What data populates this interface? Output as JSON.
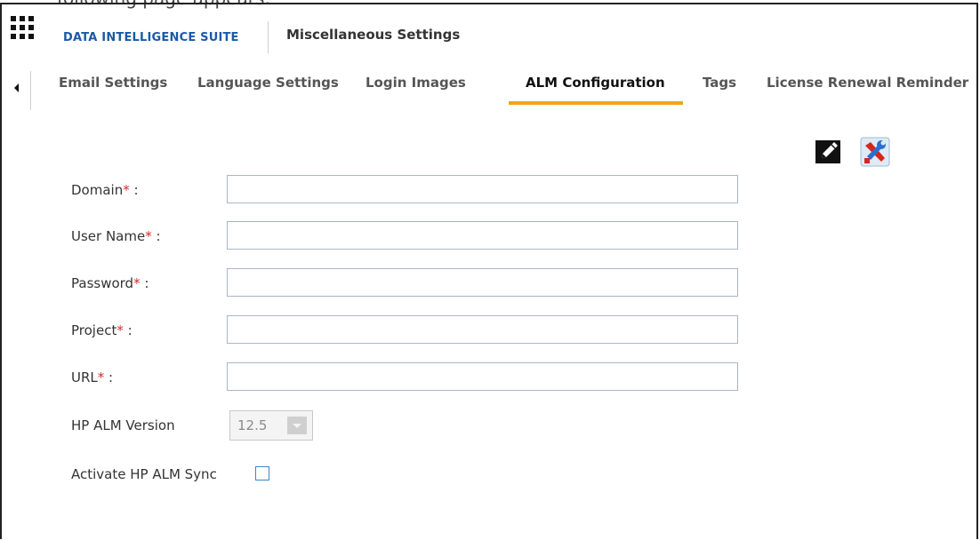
{
  "top_caption": "following page appears:",
  "header": {
    "app_menu_icon": "grid-icon",
    "suite_title": "DATA INTELLIGENCE SUITE",
    "page_title": "Miscellaneous Settings"
  },
  "tabs": [
    {
      "label": "Email Settings",
      "active": false
    },
    {
      "label": "Language Settings",
      "active": false
    },
    {
      "label": "Login Images",
      "active": false
    },
    {
      "label": "ALM Configuration",
      "active": true
    },
    {
      "label": "Tags",
      "active": false
    },
    {
      "label": "License Renewal Reminder",
      "active": false
    }
  ],
  "tab_scroll_icon": "caret-left-icon",
  "toolbar": {
    "edit_icon": "edit-pencil-icon",
    "config_icon": "tools-icon"
  },
  "form": {
    "fields": [
      {
        "label": "Domain",
        "required_mark": "*",
        "suffix": " :",
        "value": ""
      },
      {
        "label": "User Name",
        "required_mark": "*",
        "suffix": " :",
        "value": ""
      },
      {
        "label": "Password",
        "required_mark": "*",
        "suffix": " :",
        "value": ""
      },
      {
        "label": "Project",
        "required_mark": "*",
        "suffix": " :",
        "value": ""
      },
      {
        "label": "URL",
        "required_mark": "*",
        "suffix": " :",
        "value": ""
      }
    ],
    "version_label": "HP ALM Version",
    "version_value": "12.5",
    "sync_label": "Activate HP ALM Sync",
    "sync_checked": false
  },
  "colors": {
    "accent": "#f5a21b",
    "brand": "#1a5aa6",
    "required": "#d12b2b"
  }
}
